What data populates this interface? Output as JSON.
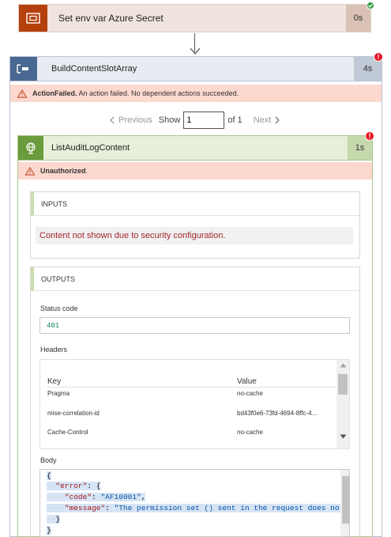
{
  "step_env": {
    "title": "Set env var Azure Secret",
    "duration": "0s",
    "status_icon": "check-icon"
  },
  "build_slot": {
    "title": "BuildContentSlotArray",
    "duration": "4s",
    "error_bold": "ActionFailed.",
    "error_text": " An action failed. No dependent actions succeeded."
  },
  "pager": {
    "previous": "Previous",
    "show": "Show",
    "current": "1",
    "of": "of 1",
    "next": "Next"
  },
  "audit": {
    "title": "ListAuditLogContent",
    "duration": "1s",
    "error_bold": "Unauthorized",
    "error_tail": "."
  },
  "inputs": {
    "heading": "INPUTS",
    "message": "Content not shown due to security configuration."
  },
  "outputs": {
    "heading": "OUTPUTS",
    "status_label": "Status code",
    "status_value": "401",
    "headers_label": "Headers",
    "headers_columns": {
      "key": "Key",
      "value": "Value"
    },
    "headers_rows": [
      {
        "key": "Pragma",
        "value": "no-cache"
      },
      {
        "key": "mise-correlation-id",
        "value": "bd43f0e6-73fd-4694-8ffc-4..."
      },
      {
        "key": "Cache-Control",
        "value": "no-cache"
      }
    ],
    "body_label": "Body",
    "body_lines": {
      "l1": "{",
      "l2_key": "\"error\"",
      "l2_rest": ": {",
      "l3_key": "\"code\"",
      "l3_sep": ": ",
      "l3_val": "\"AF10001\"",
      "l3_end": ",",
      "l4_key": "\"message\"",
      "l4_sep": ": ",
      "l4_val": "\"The permission set () sent in the request does not",
      "l5": "}",
      "l6": "}"
    }
  },
  "colors": {
    "env_accent": "#b4400d",
    "build_accent": "#4a6992",
    "audit_accent": "#6a9c3e",
    "error_red": "#e81123",
    "success_green": "#2e9a3b",
    "error_banner": "#fcd8cf"
  }
}
